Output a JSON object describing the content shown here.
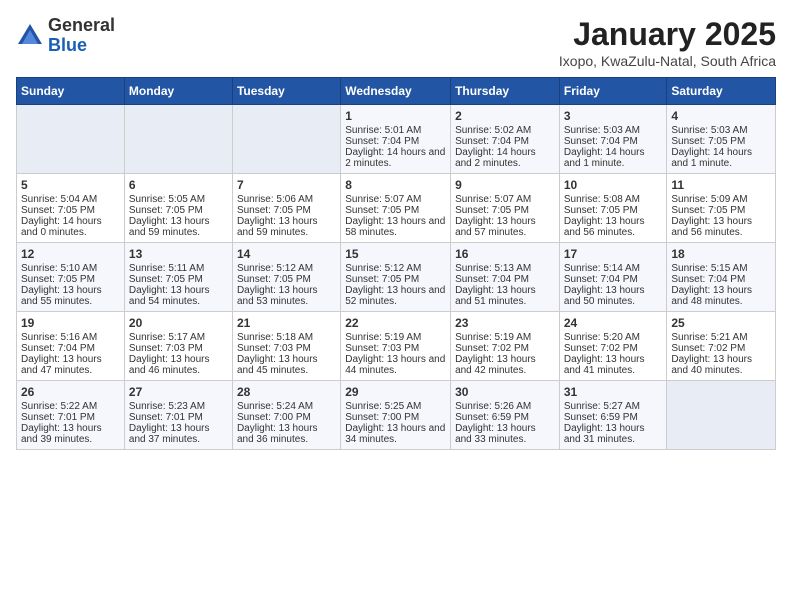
{
  "header": {
    "logo": {
      "line1": "General",
      "line2": "Blue"
    },
    "title": "January 2025",
    "location": "Ixopo, KwaZulu-Natal, South Africa"
  },
  "weekdays": [
    "Sunday",
    "Monday",
    "Tuesday",
    "Wednesday",
    "Thursday",
    "Friday",
    "Saturday"
  ],
  "weeks": [
    [
      {
        "day": "",
        "sunrise": "",
        "sunset": "",
        "daylight": ""
      },
      {
        "day": "",
        "sunrise": "",
        "sunset": "",
        "daylight": ""
      },
      {
        "day": "",
        "sunrise": "",
        "sunset": "",
        "daylight": ""
      },
      {
        "day": "1",
        "sunrise": "Sunrise: 5:01 AM",
        "sunset": "Sunset: 7:04 PM",
        "daylight": "Daylight: 14 hours and 2 minutes."
      },
      {
        "day": "2",
        "sunrise": "Sunrise: 5:02 AM",
        "sunset": "Sunset: 7:04 PM",
        "daylight": "Daylight: 14 hours and 2 minutes."
      },
      {
        "day": "3",
        "sunrise": "Sunrise: 5:03 AM",
        "sunset": "Sunset: 7:04 PM",
        "daylight": "Daylight: 14 hours and 1 minute."
      },
      {
        "day": "4",
        "sunrise": "Sunrise: 5:03 AM",
        "sunset": "Sunset: 7:05 PM",
        "daylight": "Daylight: 14 hours and 1 minute."
      }
    ],
    [
      {
        "day": "5",
        "sunrise": "Sunrise: 5:04 AM",
        "sunset": "Sunset: 7:05 PM",
        "daylight": "Daylight: 14 hours and 0 minutes."
      },
      {
        "day": "6",
        "sunrise": "Sunrise: 5:05 AM",
        "sunset": "Sunset: 7:05 PM",
        "daylight": "Daylight: 13 hours and 59 minutes."
      },
      {
        "day": "7",
        "sunrise": "Sunrise: 5:06 AM",
        "sunset": "Sunset: 7:05 PM",
        "daylight": "Daylight: 13 hours and 59 minutes."
      },
      {
        "day": "8",
        "sunrise": "Sunrise: 5:07 AM",
        "sunset": "Sunset: 7:05 PM",
        "daylight": "Daylight: 13 hours and 58 minutes."
      },
      {
        "day": "9",
        "sunrise": "Sunrise: 5:07 AM",
        "sunset": "Sunset: 7:05 PM",
        "daylight": "Daylight: 13 hours and 57 minutes."
      },
      {
        "day": "10",
        "sunrise": "Sunrise: 5:08 AM",
        "sunset": "Sunset: 7:05 PM",
        "daylight": "Daylight: 13 hours and 56 minutes."
      },
      {
        "day": "11",
        "sunrise": "Sunrise: 5:09 AM",
        "sunset": "Sunset: 7:05 PM",
        "daylight": "Daylight: 13 hours and 56 minutes."
      }
    ],
    [
      {
        "day": "12",
        "sunrise": "Sunrise: 5:10 AM",
        "sunset": "Sunset: 7:05 PM",
        "daylight": "Daylight: 13 hours and 55 minutes."
      },
      {
        "day": "13",
        "sunrise": "Sunrise: 5:11 AM",
        "sunset": "Sunset: 7:05 PM",
        "daylight": "Daylight: 13 hours and 54 minutes."
      },
      {
        "day": "14",
        "sunrise": "Sunrise: 5:12 AM",
        "sunset": "Sunset: 7:05 PM",
        "daylight": "Daylight: 13 hours and 53 minutes."
      },
      {
        "day": "15",
        "sunrise": "Sunrise: 5:12 AM",
        "sunset": "Sunset: 7:05 PM",
        "daylight": "Daylight: 13 hours and 52 minutes."
      },
      {
        "day": "16",
        "sunrise": "Sunrise: 5:13 AM",
        "sunset": "Sunset: 7:04 PM",
        "daylight": "Daylight: 13 hours and 51 minutes."
      },
      {
        "day": "17",
        "sunrise": "Sunrise: 5:14 AM",
        "sunset": "Sunset: 7:04 PM",
        "daylight": "Daylight: 13 hours and 50 minutes."
      },
      {
        "day": "18",
        "sunrise": "Sunrise: 5:15 AM",
        "sunset": "Sunset: 7:04 PM",
        "daylight": "Daylight: 13 hours and 48 minutes."
      }
    ],
    [
      {
        "day": "19",
        "sunrise": "Sunrise: 5:16 AM",
        "sunset": "Sunset: 7:04 PM",
        "daylight": "Daylight: 13 hours and 47 minutes."
      },
      {
        "day": "20",
        "sunrise": "Sunrise: 5:17 AM",
        "sunset": "Sunset: 7:03 PM",
        "daylight": "Daylight: 13 hours and 46 minutes."
      },
      {
        "day": "21",
        "sunrise": "Sunrise: 5:18 AM",
        "sunset": "Sunset: 7:03 PM",
        "daylight": "Daylight: 13 hours and 45 minutes."
      },
      {
        "day": "22",
        "sunrise": "Sunrise: 5:19 AM",
        "sunset": "Sunset: 7:03 PM",
        "daylight": "Daylight: 13 hours and 44 minutes."
      },
      {
        "day": "23",
        "sunrise": "Sunrise: 5:19 AM",
        "sunset": "Sunset: 7:02 PM",
        "daylight": "Daylight: 13 hours and 42 minutes."
      },
      {
        "day": "24",
        "sunrise": "Sunrise: 5:20 AM",
        "sunset": "Sunset: 7:02 PM",
        "daylight": "Daylight: 13 hours and 41 minutes."
      },
      {
        "day": "25",
        "sunrise": "Sunrise: 5:21 AM",
        "sunset": "Sunset: 7:02 PM",
        "daylight": "Daylight: 13 hours and 40 minutes."
      }
    ],
    [
      {
        "day": "26",
        "sunrise": "Sunrise: 5:22 AM",
        "sunset": "Sunset: 7:01 PM",
        "daylight": "Daylight: 13 hours and 39 minutes."
      },
      {
        "day": "27",
        "sunrise": "Sunrise: 5:23 AM",
        "sunset": "Sunset: 7:01 PM",
        "daylight": "Daylight: 13 hours and 37 minutes."
      },
      {
        "day": "28",
        "sunrise": "Sunrise: 5:24 AM",
        "sunset": "Sunset: 7:00 PM",
        "daylight": "Daylight: 13 hours and 36 minutes."
      },
      {
        "day": "29",
        "sunrise": "Sunrise: 5:25 AM",
        "sunset": "Sunset: 7:00 PM",
        "daylight": "Daylight: 13 hours and 34 minutes."
      },
      {
        "day": "30",
        "sunrise": "Sunrise: 5:26 AM",
        "sunset": "Sunset: 6:59 PM",
        "daylight": "Daylight: 13 hours and 33 minutes."
      },
      {
        "day": "31",
        "sunrise": "Sunrise: 5:27 AM",
        "sunset": "Sunset: 6:59 PM",
        "daylight": "Daylight: 13 hours and 31 minutes."
      },
      {
        "day": "",
        "sunrise": "",
        "sunset": "",
        "daylight": ""
      }
    ]
  ]
}
